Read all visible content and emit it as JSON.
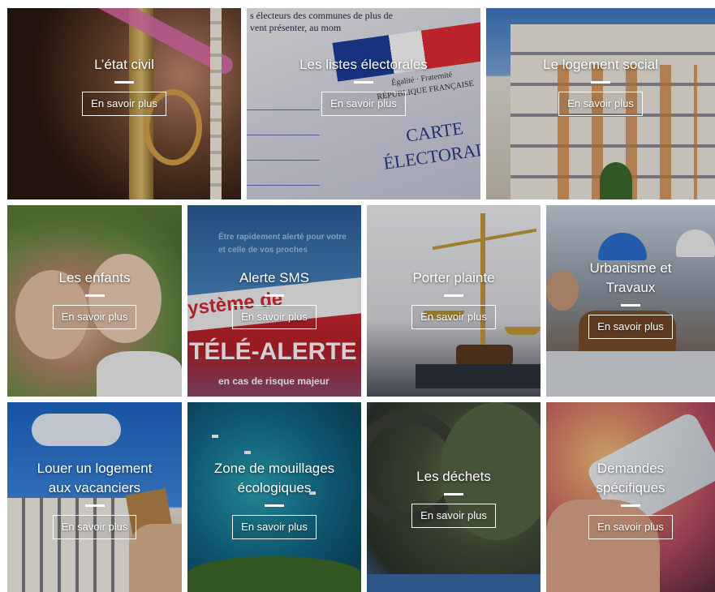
{
  "tiles": [
    {
      "id": "etat-civil",
      "title": "L’état civil",
      "button": "En savoir plus"
    },
    {
      "id": "listes-electorales",
      "title": "Les listes électorales",
      "button": "En savoir plus"
    },
    {
      "id": "logement-social",
      "title": "Le logement social",
      "button": "En savoir plus"
    },
    {
      "id": "enfants",
      "title": "Les enfants",
      "button": "En savoir plus"
    },
    {
      "id": "alerte-sms",
      "title": "Alerte SMS",
      "button": "En savoir plus"
    },
    {
      "id": "porter-plainte",
      "title": "Porter plainte",
      "button": "En savoir plus"
    },
    {
      "id": "urbanisme-travaux",
      "title": "Urbanisme et\nTravaux",
      "button": "En savoir plus"
    },
    {
      "id": "louer-logement",
      "title": "Louer un logement\naux vacanciers",
      "button": "En savoir plus"
    },
    {
      "id": "zone-mouillages",
      "title": "Zone de mouillages\nécologiques",
      "button": "En savoir plus"
    },
    {
      "id": "dechets",
      "title": "Les déchets",
      "button": "En savoir plus"
    },
    {
      "id": "demandes-specifiques",
      "title": "Demandes\nspécifiques",
      "button": "En savoir plus"
    }
  ],
  "image_text": {
    "listes": {
      "top_line_1": "s électeurs des communes de plus de",
      "top_line_2": "vent présenter, au mom",
      "rf_1": "Égalité · Fraternité",
      "rf_2": "RÉPUBLIQUE FRANÇAISE",
      "carte": "CARTE",
      "electoral": "ÉLECTORAL"
    },
    "sms": {
      "line_1": "Être rapidement alerté pour votre",
      "line_2": "et celle de vos proches",
      "systeme": "ystème de",
      "tele_alerte": "TÉLÉ-ALERTE",
      "risque": "en cas de risque majeur"
    }
  }
}
